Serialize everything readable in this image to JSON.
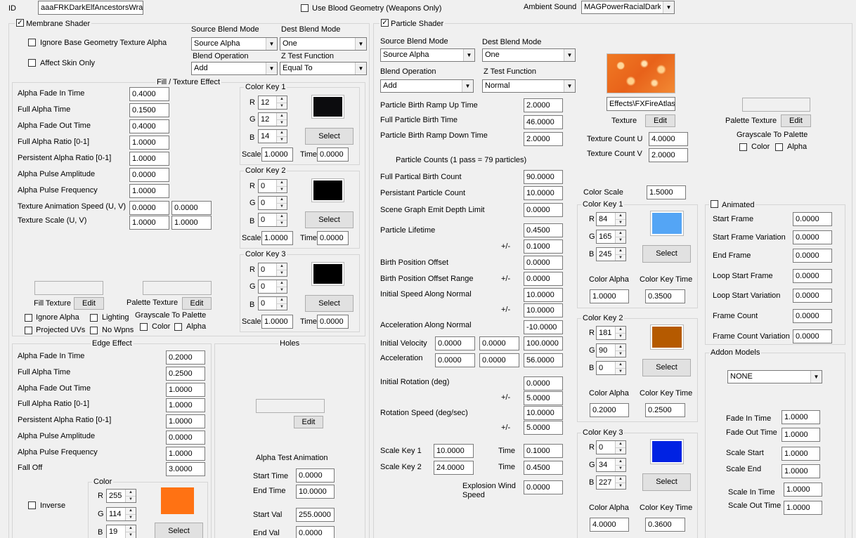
{
  "header": {
    "id_label": "ID",
    "id_value": "aaaFRKDarkElfAncestorsWrath",
    "blood_geometry_label": "Use Blood Geometry (Weapons Only)",
    "ambient_label": "Ambient Sound",
    "ambient_value": "MAGPowerRacialDarkElf"
  },
  "membrane": {
    "title": "Membrane Shader",
    "ignore_alpha": "Ignore Base Geometry Texture Alpha",
    "affect_skin": "Affect Skin Only",
    "source_blend_label": "Source Blend Mode",
    "source_blend_value": "Source Alpha",
    "dest_blend_label": "Dest Blend Mode",
    "dest_blend_value": "One",
    "blend_op_label": "Blend Operation",
    "blend_op_value": "Add",
    "ztest_label": "Z Test Function",
    "ztest_value": "Equal To"
  },
  "fill": {
    "title": "Fill / Texture Effect",
    "rows": [
      {
        "label": "Alpha Fade In Time",
        "v": "0.4000"
      },
      {
        "label": "Full Alpha Time",
        "v": "0.1500"
      },
      {
        "label": "Alpha Fade Out Time",
        "v": "0.4000"
      },
      {
        "label": "Full Alpha Ratio [0-1]",
        "v": "1.0000"
      },
      {
        "label": "Persistent Alpha Ratio [0-1]",
        "v": "1.0000"
      },
      {
        "label": "Alpha Pulse Amplitude",
        "v": "0.0000"
      },
      {
        "label": "Alpha Pulse Frequency",
        "v": "1.0000"
      }
    ],
    "anim_speed_label": "Texture Animation Speed (U, V)",
    "anim_u": "0.0000",
    "anim_v": "0.0000",
    "scale_label": "Texture Scale (U, V)",
    "scale_u": "1.0000",
    "scale_v": "1.0000",
    "fill_texture_label": "Fill Texture",
    "palette_texture_label": "Palette Texture",
    "edit": "Edit",
    "ignore_alpha": "Ignore Alpha",
    "lighting": "Lighting",
    "projected_uvs": "Projected UVs",
    "no_wpns": "No Wpns",
    "grayscale": "Grayscale To Palette",
    "color": "Color",
    "alpha": "Alpha"
  },
  "fill_keys": [
    {
      "title": "Color Key 1",
      "r": "12",
      "g": "12",
      "b": "14",
      "scale": "1.0000",
      "time": "0.0000",
      "color": "#0c0c0e"
    },
    {
      "title": "Color Key 2",
      "r": "0",
      "g": "0",
      "b": "0",
      "scale": "1.0000",
      "time": "0.0000",
      "color": "#000000"
    },
    {
      "title": "Color Key 3",
      "r": "0",
      "g": "0",
      "b": "0",
      "scale": "1.0000",
      "time": "0.0000",
      "color": "#000000"
    }
  ],
  "common": {
    "R": "R",
    "G": "G",
    "B": "B",
    "scale": "Scale",
    "time": "Time",
    "select": "Select",
    "edit": "Edit",
    "color_alpha": "Color Alpha",
    "color_key_time": "Color Key Time"
  },
  "edge": {
    "title": "Edge Effect",
    "rows": [
      {
        "label": "Alpha Fade In Time",
        "v": "0.2000"
      },
      {
        "label": "Full Alpha Time",
        "v": "0.2500"
      },
      {
        "label": "Alpha Fade Out Time",
        "v": "1.0000"
      },
      {
        "label": "Full Alpha Ratio [0-1]",
        "v": "1.0000"
      },
      {
        "label": "Persistent Alpha Ratio [0-1]",
        "v": "1.0000"
      },
      {
        "label": "Alpha Pulse Amplitude",
        "v": "0.0000"
      },
      {
        "label": "Alpha Pulse Frequency",
        "v": "1.0000"
      },
      {
        "label": "Fall Off",
        "v": "3.0000"
      }
    ],
    "inverse": "Inverse",
    "color_title": "Color",
    "r": "255",
    "g": "114",
    "b": "19",
    "swatch": "#ff7213"
  },
  "holes": {
    "title": "Holes",
    "edit": "Edit",
    "anim_title": "Alpha Test Animation",
    "start_time_label": "Start Time",
    "start_time": "0.0000",
    "end_time_label": "End Time",
    "end_time": "10.0000",
    "start_val_label": "Start Val",
    "start_val": "255.0000",
    "end_val_label": "End Val",
    "end_val": "0.0000"
  },
  "particle": {
    "title": "Particle Shader",
    "source_blend_label": "Source Blend Mode",
    "source_blend_value": "Source Alpha",
    "dest_blend_label": "Dest Blend Mode",
    "dest_blend_value": "One",
    "blend_op_label": "Blend Operation",
    "blend_op_value": "Add",
    "ztest_label": "Z Test Function",
    "ztest_value": "Normal",
    "birth_ramp_up_label": "Particle Birth Ramp Up Time",
    "birth_ramp_up": "2.0000",
    "full_birth_label": "Full Particle Birth Time",
    "full_birth": "46.0000",
    "birth_ramp_down_label": "Particle Birth Ramp Down Time",
    "birth_ramp_down": "2.0000",
    "counts_heading": "Particle Counts (1 pass = 79 particles)",
    "full_partical_label": "Full Partical Birth Count",
    "full_partical": "90.0000",
    "persistant_label": "Persistant Particle Count",
    "persistant": "10.0000",
    "scene_graph_label": "Scene Graph Emit Depth Limit",
    "scene_graph": "0.0000",
    "lifetime_label": "Particle Lifetime",
    "lifetime": "0.4500",
    "pm": "+/-",
    "lifetime_var": "0.1000",
    "birth_pos_label": "Birth Position Offset",
    "birth_pos": "0.0000",
    "birth_pos_range_label": "Birth Position Offset Range",
    "birth_pos_range": "0.0000",
    "init_speed_label": "Initial Speed Along Normal",
    "init_speed": "10.0000",
    "init_speed_var": "10.0000",
    "accel_normal_label": "Acceleration Along Normal",
    "accel_normal": "-10.0000",
    "init_vel_label": "Initial Velocity",
    "init_vel_x": "0.0000",
    "init_vel_y": "0.0000",
    "init_vel_z": "100.0000",
    "accel_label": "Acceleration",
    "accel_x": "0.0000",
    "accel_y": "0.0000",
    "accel_z": "56.0000",
    "init_rot_label": "Initial Rotation (deg)",
    "init_rot": "0.0000",
    "init_rot_var": "5.0000",
    "rot_speed_label": "Rotation Speed (deg/sec)",
    "rot_speed": "10.0000",
    "rot_speed_var": "5.0000",
    "scale_key1_label": "Scale Key 1",
    "scale_key1": "10.0000",
    "scale_key1_time": "0.1000",
    "scale_key2_label": "Scale Key 2",
    "scale_key2": "24.0000",
    "scale_key2_time": "0.4500",
    "time_label": "Time",
    "explosion_label_1": "Explosion Wind",
    "explosion_label_2": "Speed",
    "explosion": "0.0000",
    "texture_path": "Effects\\FXFireAtlas",
    "texture_label": "Texture",
    "palette_label": "Palette Texture",
    "grayscale": "Grayscale To Palette",
    "color": "Color",
    "alpha": "Alpha",
    "tex_count_u_label": "Texture Count U",
    "tex_count_u": "4.0000",
    "tex_count_v_label": "Texture Count V",
    "tex_count_v": "2.0000",
    "color_scale_label": "Color Scale",
    "color_scale": "1.5000"
  },
  "particle_keys": [
    {
      "title": "Color Key 1",
      "r": "84",
      "g": "165",
      "b": "245",
      "alpha": "1.0000",
      "time": "0.3500",
      "color": "#54a5f5"
    },
    {
      "title": "Color Key 2",
      "r": "181",
      "g": "90",
      "b": "0",
      "alpha": "0.2000",
      "time": "0.2500",
      "color": "#b55a00"
    },
    {
      "title": "Color Key 3",
      "r": "0",
      "g": "34",
      "b": "227",
      "alpha": "4.0000",
      "time": "0.3600",
      "color": "#0022e3"
    }
  ],
  "animated": {
    "title": "Animated",
    "rows": [
      {
        "label": "Start Frame",
        "v": "0.0000"
      },
      {
        "label": "Start Frame Variation",
        "v": "0.0000"
      },
      {
        "label": "End Frame",
        "v": "0.0000"
      },
      {
        "label": "Loop Start Frame",
        "v": "0.0000"
      },
      {
        "label": "Loop Start Variation",
        "v": "0.0000"
      },
      {
        "label": "Frame Count",
        "v": "0.0000"
      },
      {
        "label": "Frame Count Variation",
        "v": "0.0000"
      }
    ]
  },
  "addon": {
    "title": "Addon Models",
    "value": "NONE",
    "rows": [
      {
        "label": "Fade In Time",
        "v": "1.0000"
      },
      {
        "label": "Fade Out Time",
        "v": "1.0000"
      },
      {
        "label": "Scale Start",
        "v": "1.0000"
      },
      {
        "label": "Scale End",
        "v": "1.0000"
      },
      {
        "label": "Scale In Time",
        "v": "1.0000"
      },
      {
        "label": "Scale Out Time",
        "v": "1.0000"
      }
    ]
  }
}
